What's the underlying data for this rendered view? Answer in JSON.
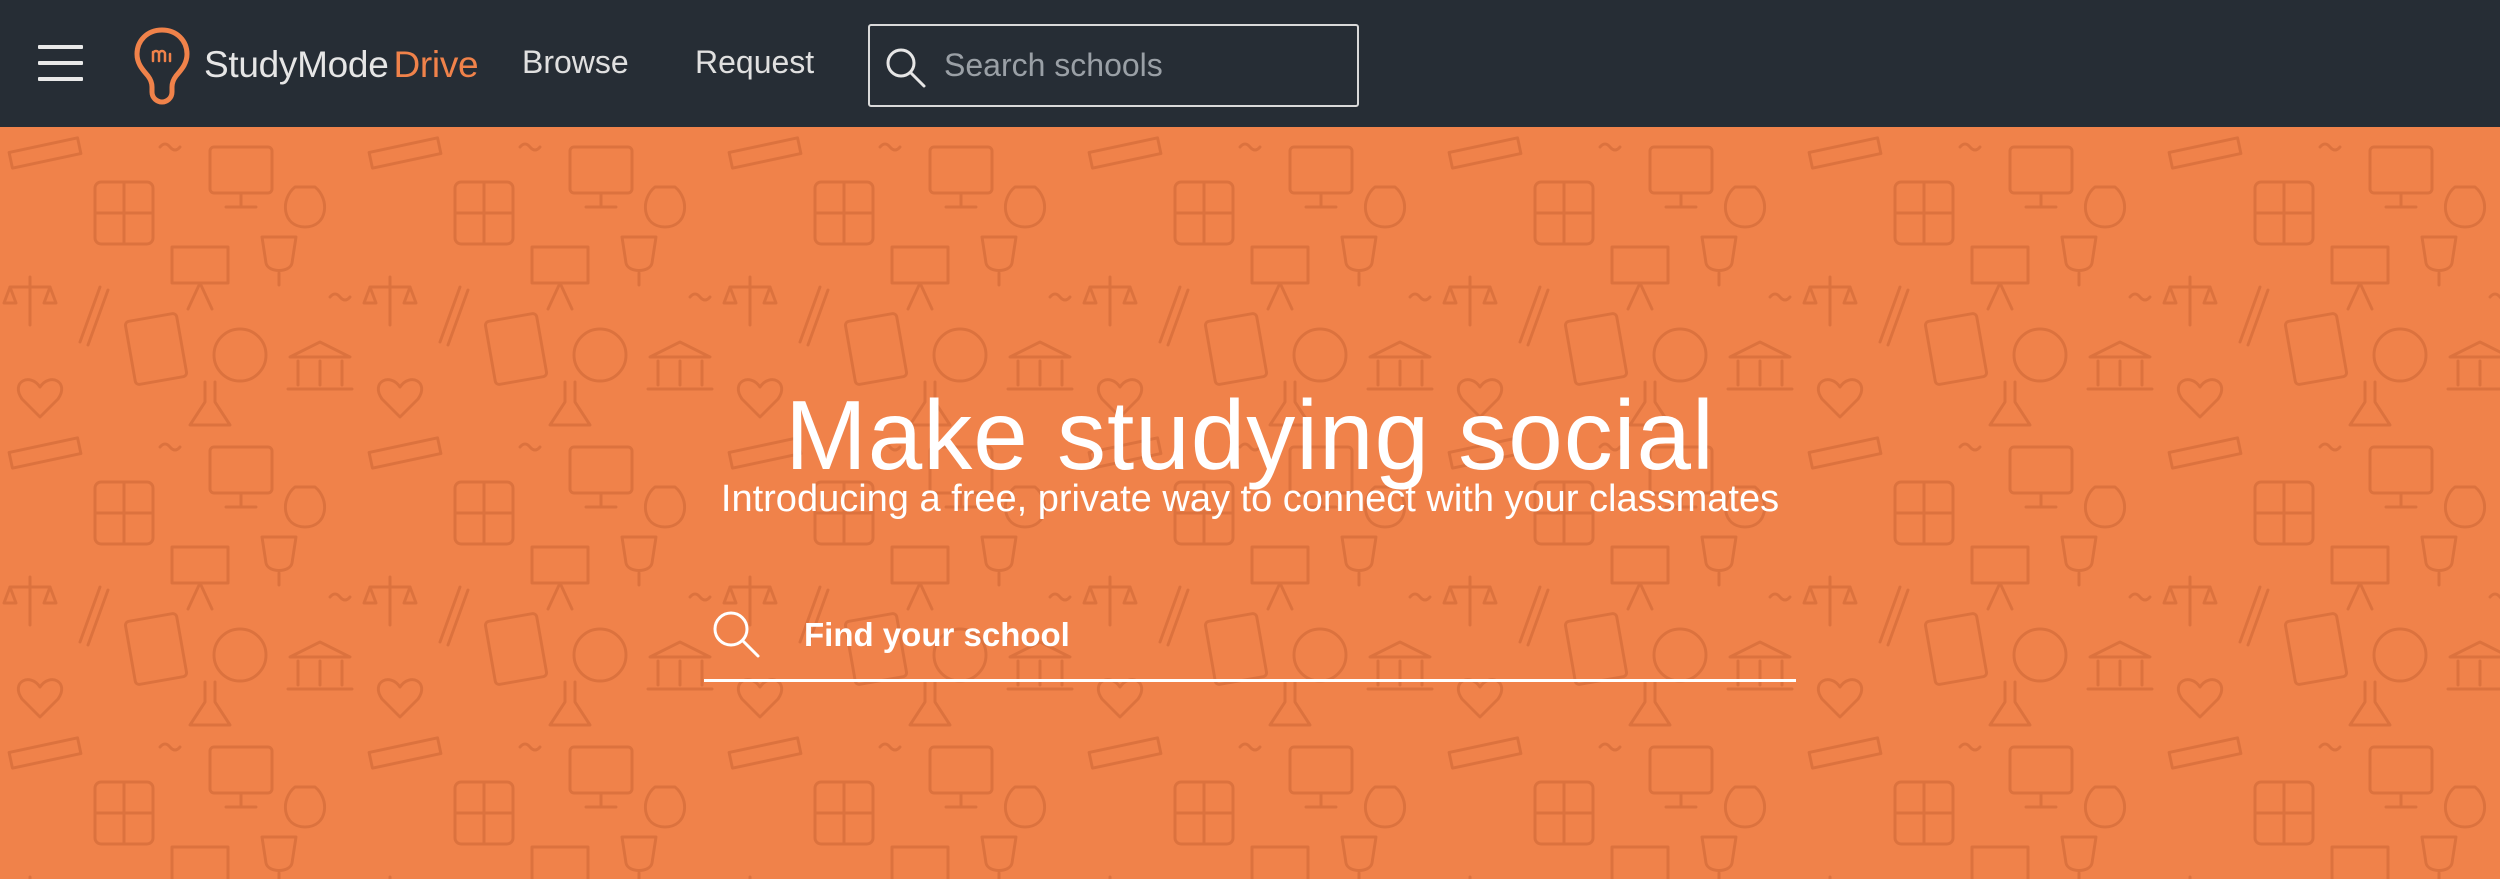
{
  "navbar": {
    "menu_icon": "hamburger-menu-icon",
    "brand": {
      "icon": "lightbulb-logo-icon",
      "name_main": "StudyMode",
      "name_accent": "Drive",
      "accent_color": "#f0824a"
    },
    "links": {
      "browse": "Browse",
      "request": "Request"
    },
    "search": {
      "icon": "search-icon",
      "placeholder": "Search schools",
      "value": ""
    },
    "background_color": "#262d35"
  },
  "hero": {
    "title": "Make studying social",
    "subtitle": "Introducing a free, private way to connect with your classmates",
    "search": {
      "icon": "search-icon",
      "placeholder": "Find your school",
      "value": ""
    },
    "background_color": "#f0824a",
    "pattern_color": "#d9703c"
  }
}
